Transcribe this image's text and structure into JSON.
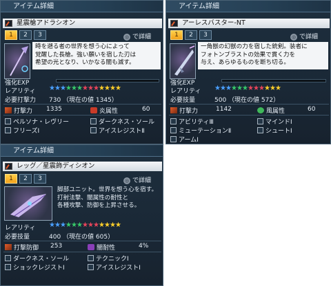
{
  "panels": [
    {
      "title": "アイテム詳細",
      "name": "星震槍アドラシオン",
      "tabs": [
        "1",
        "2",
        "3"
      ],
      "detail": "で詳細",
      "desc": [
        "時を遡る者の世界を想う心によって",
        "覚醒した長槍。強い願いを宿した刃は",
        "希望の光となり、いかなる闇も滅す。"
      ],
      "exp_label": "強化EXP",
      "rarity_label": "レアリティ",
      "req_label": "必要打撃力",
      "req_value": "730 （現在の値 1345）",
      "stat1_label": "打撃力",
      "stat1_value": "1335",
      "stat2_label": "炎属性",
      "stat2_value": "60",
      "abilities": [
        "ペルソナ・レヴリー",
        "ダークネス・ソール",
        "フリーズⅠ",
        "アイスレジストⅡ"
      ]
    },
    {
      "title": "アイテム詳細",
      "name": "アーレスバスター-NT",
      "tabs": [
        "1",
        "2",
        "3"
      ],
      "detail": "で詳細",
      "desc": [
        "一角獣の幻獣の力を宿した銃剣。装者に",
        "フォトンブラストの効果で貫く力を",
        "与え、あらゆるものを断ち切る。"
      ],
      "exp_label": "強化EXP",
      "rarity_label": "レアリティ",
      "req_label": "必要技量",
      "req_value": "500 （現在の値 572）",
      "stat1_label": "打撃力",
      "stat1_value": "1142",
      "stat2_label": "風属性",
      "stat2_value": "60",
      "abilities": [
        "アビリティⅢ",
        "マインドⅠ",
        "ミューテーションⅡ",
        "シュートⅠ",
        "アームⅠ"
      ]
    },
    {
      "title": "アイテム詳細",
      "name": "レッグ／星震飾ディシオン",
      "tabs": [
        "1",
        "2",
        "3"
      ],
      "detail": "で詳細",
      "desc": [
        "脚部ユニット。世界を想う心を宿す。",
        "打射法撃、闇属性の耐性と",
        "各種攻撃、防御を上昇させる。"
      ],
      "rarity_label": "レアリティ",
      "req_label": "必要技量",
      "req_value": "400 （現在の値 605）",
      "stat1_label": "打撃防御",
      "stat1_value": "253",
      "stat2_label": "闇耐性",
      "stat2_value": "4%",
      "abilities": [
        "ダークネス・ソール",
        "テクニックⅠ",
        "ショックレジストⅠ",
        "アイスレジストⅠ"
      ]
    }
  ],
  "colors": {
    "accent": "#f2a11a",
    "panel": "#1c2b39"
  }
}
